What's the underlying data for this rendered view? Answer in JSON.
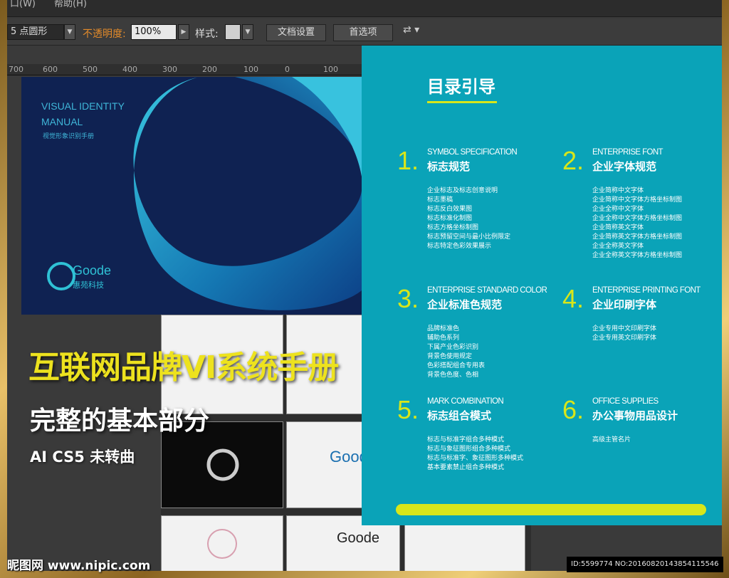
{
  "menubar": {
    "items": [
      "口(W)",
      "帮助(H)"
    ]
  },
  "control_bar": {
    "brush_value": "5 点圆形",
    "opacity_label": "不透明度:",
    "opacity_value": "100%",
    "style_label": "样式:",
    "doc_setup_button": "文档设置",
    "preferences_button": "首选项"
  },
  "ruler": {
    "ticks": [
      "700",
      "600",
      "500",
      "400",
      "300",
      "200",
      "100",
      "0",
      "100"
    ]
  },
  "cover": {
    "title_line1": "VISUAL IDENTITY",
    "title_line2": "MANUAL",
    "subtitle_cn": "视觉形象识别手册",
    "logo_word": "Goode",
    "logo_cn": "惠苑科技"
  },
  "toc": {
    "title": "目录引导",
    "sections": [
      {
        "num": "1.",
        "en": "SYMBOL SPECIFICATION",
        "cn": "标志规范",
        "items": [
          "企业标志及标志创意说明",
          "标志墨稿",
          "标志反白效果图",
          "标志标准化制图",
          "标志方格坐标制图",
          "标志预留空间与最小比例限定",
          "标志特定色彩效果展示"
        ]
      },
      {
        "num": "2.",
        "en": "ENTERPRISE FONT",
        "cn": "企业字体规范",
        "items": [
          "企业简称中文字体",
          "企业简称中文字体方格坐标制图",
          "企业全称中文字体",
          "企业全称中文字体方格坐标制图",
          "企业简称英文字体",
          "企业简称英文字体方格坐标制图",
          "企业全称英文字体",
          "企业全称英文字体方格坐标制图"
        ]
      },
      {
        "num": "3.",
        "en": "ENTERPRISE STANDARD COLOR",
        "cn": "企业标准色规范",
        "items": [
          "品牌标准色",
          "辅助色系列",
          "下属产业色彩识别",
          "背景色使用规定",
          "色彩搭配组合专用表",
          "背景色色度、色相"
        ]
      },
      {
        "num": "4.",
        "en": "ENTERPRISE PRINTING FONT",
        "cn": "企业印刷字体",
        "items": [
          "企业专用中文印刷字体",
          "企业专用英文印刷字体"
        ]
      },
      {
        "num": "5.",
        "en": "MARK COMBINATION",
        "cn": "标志组合模式",
        "items": [
          "标志与标准字组合多种模式",
          "标志与象征图形组合多种模式",
          "标志与标准字、象征图形多种模式",
          "基本要素禁止组合多种模式"
        ]
      },
      {
        "num": "6.",
        "en": "OFFICE SUPPLIES",
        "cn": "办公事物用品设计",
        "items": [
          "高级主管名片"
        ]
      }
    ]
  },
  "headline": {
    "line1": "互联网品牌VI系统手册",
    "line2": "完整的基本部分",
    "line3": "AI CS5 未转曲"
  },
  "thumbs": {
    "logo_word": "Goode"
  },
  "watermark": {
    "site": "昵图网 www.nipic.com",
    "id": "ID:5599774 NO:20160820143854115546"
  },
  "colors": {
    "teal": "#0aa3b8",
    "lime": "#d8e61a",
    "navy": "#0f2252",
    "gold": "#e8c068"
  }
}
